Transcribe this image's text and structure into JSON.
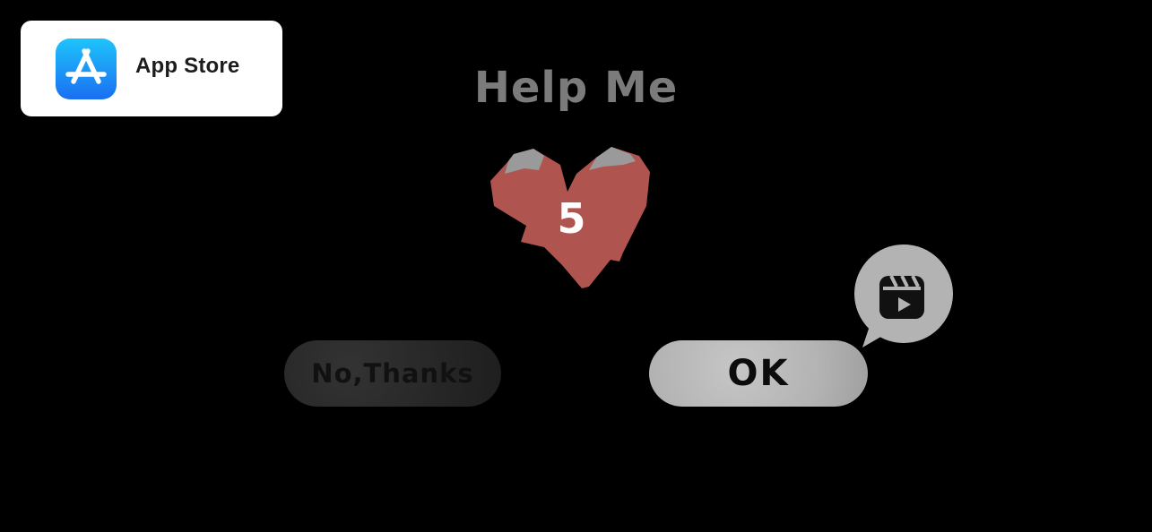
{
  "badge": {
    "label": "App Store",
    "icon": "app-store-icon"
  },
  "dialog": {
    "title": "Help Me",
    "heart_count": "5",
    "heart_icon": "heart-icon",
    "no_label": "No,Thanks",
    "ok_label": "OK",
    "video_icon": "video-clapper-icon"
  },
  "colors": {
    "background": "#000000",
    "title": "#7b7b7b",
    "heart": "#b05450",
    "heart_top": "#9a9a9a",
    "ok_button": "#b9b9b9",
    "no_button": "#2a2a2a"
  }
}
